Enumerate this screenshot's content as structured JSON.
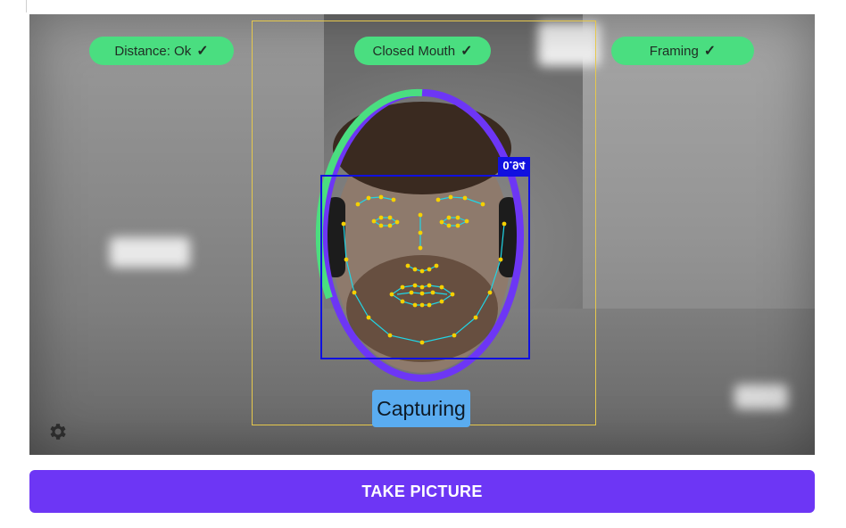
{
  "status_pills": {
    "distance": {
      "label": "Distance: Ok",
      "icon": "check-icon",
      "color": "#4ade80"
    },
    "closed_mouth": {
      "label": "Closed Mouth",
      "icon": "check-icon",
      "color": "#4ade80"
    },
    "framing": {
      "label": "Framing",
      "icon": "check-icon",
      "color": "#4ade80"
    }
  },
  "detection": {
    "confidence": "0.94",
    "box_color": "#1010e0",
    "oval_progress_color": "#4ade80",
    "oval_remaining_color": "#6d36f5",
    "landmark_color": "#f5d000",
    "mesh_color": "#20d6e6"
  },
  "capture_status": "Capturing",
  "settings": {
    "icon": "gear-icon"
  },
  "take_picture": {
    "label": "TAKE PICTURE",
    "color": "#6d36f5"
  }
}
